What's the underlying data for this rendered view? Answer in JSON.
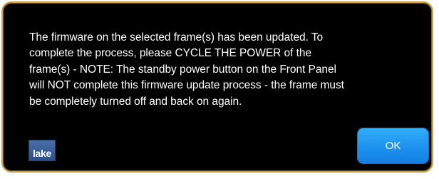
{
  "dialog": {
    "message_lines": [
      "The firmware on the selected frame(s) has been updated. To",
      "complete the process, please CYCLE THE POWER of the",
      "frame(s) - NOTE: The standby power button on the Front Panel",
      "will NOT complete this firmware update process - the frame must",
      "be completely turned off and back on again."
    ],
    "logo_text": "lake",
    "ok_label": "OK"
  },
  "colors": {
    "background": "#000000",
    "border": "#c8a24a",
    "text": "#ffffff",
    "button": "#1f96f2",
    "logo": "#3a5f98"
  }
}
